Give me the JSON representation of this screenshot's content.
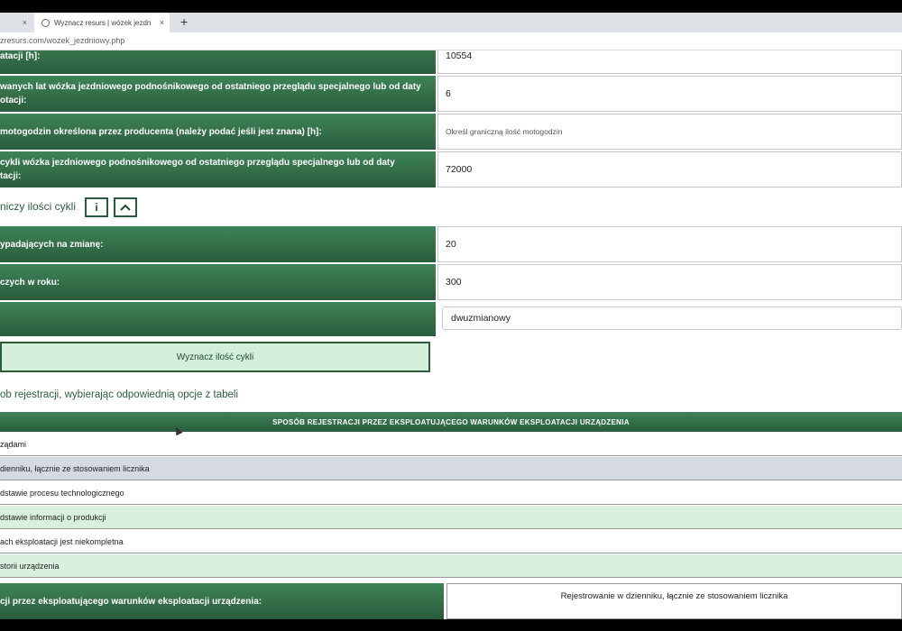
{
  "browser": {
    "tab1_close": "×",
    "tab2_title": "Wyznacz resurs | wózek jezdnio",
    "tab2_close": "×",
    "new_tab": "+",
    "url": "zresurs.com/wozek_jezdniowy.php"
  },
  "fields": [
    {
      "label_lines": [
        "",
        "atacji [h]:"
      ],
      "value": "10554"
    },
    {
      "label_lines": [
        "wanych lat wózka jezdniowego podnośnikowego od ostatniego przeglądu specjalnego lub od daty",
        "otacji:"
      ],
      "value": "6"
    },
    {
      "label_lines": [
        "motogodzin określona przez producenta (należy podać jeśli jest znana) [h]:"
      ],
      "placeholder": "Określ graniczną ilość motogodzin"
    },
    {
      "label_lines": [
        "cykli wózka jezdniowego podnośnikowego od ostatniego przeglądu specjalnego lub od daty",
        "tacji:"
      ],
      "value": "72000"
    }
  ],
  "cycles_section": {
    "title": "niczy ilości cykli",
    "info_icon": "i",
    "collapse_icon": "chevron-up-icon",
    "fields": [
      {
        "label": "ypadających na zmianę:",
        "value": "20"
      },
      {
        "label": "czych w roku:",
        "value": "300"
      }
    ],
    "shift_select": "dwuzmianowy",
    "calc_button": "Wyznacz ilość cykli"
  },
  "registration": {
    "instruction": "ob rejestracji, wybierając odpowiednią opcje z tabeli",
    "header": "SPOSÓB REJESTRACJI PRZEZ EKSPLOATUJĄCEGO WARUNKÓW EKSPLOATACJI URZĄDZENIA",
    "rows": [
      "ządami",
      "dienniku, łącznie ze stosowaniem licznika",
      "dstawie procesu technologicznego",
      "dstawie informacji o produkcji",
      "ach eksploatacji jest niekompletna",
      "storii urządzenia"
    ],
    "summary_label": "cji przez eksploatującego warunków eksploatacji urządzenia:",
    "summary_value": "Rejestrowanie w dzienniku, łącznie ze stosowaniem licznika"
  },
  "colors": {
    "header_green": "#2a5c3c",
    "row_green": "#d8f0dd",
    "row_selected": "#d4d9e4"
  }
}
